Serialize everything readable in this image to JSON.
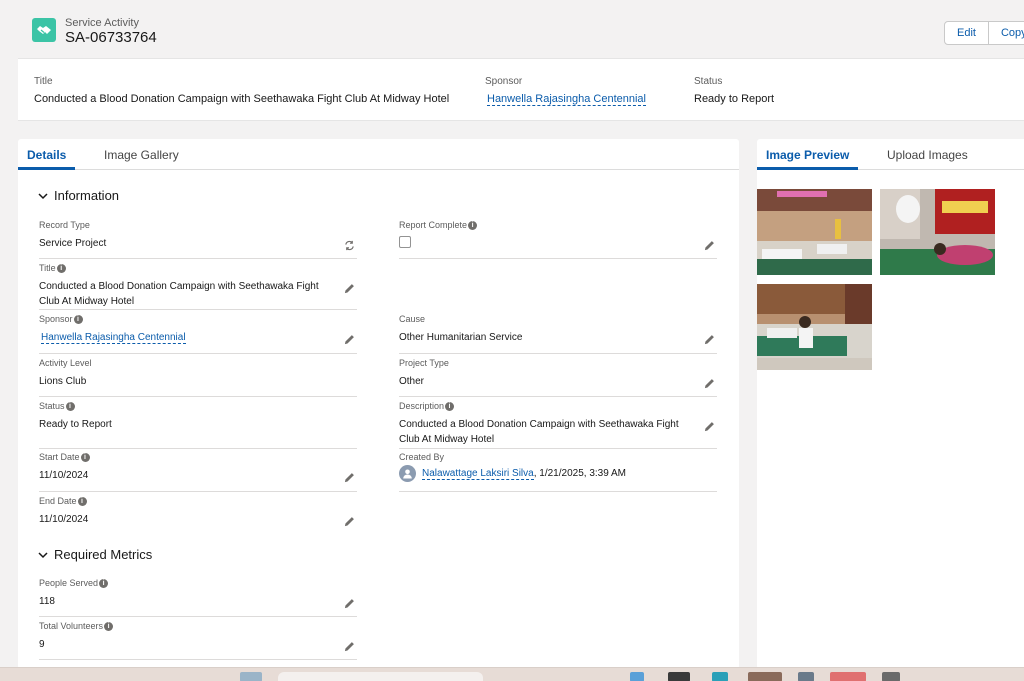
{
  "header": {
    "object_type": "Service Activity",
    "record_name": "SA-06733764",
    "buttons": {
      "edit": "Edit",
      "copy": "Copy"
    }
  },
  "highlights": {
    "title_label": "Title",
    "title_value": "Conducted a Blood Donation Campaign with Seethawaka Fight Club At Midway Hotel",
    "sponsor_label": "Sponsor",
    "sponsor_value": "Hanwella Rajasingha Centennial",
    "status_label": "Status",
    "status_value": "Ready to Report"
  },
  "main_tabs": {
    "details": "Details",
    "gallery": "Image Gallery"
  },
  "sections": {
    "information": "Information",
    "metrics": "Required Metrics"
  },
  "fields": {
    "record_type_label": "Record Type",
    "record_type_value": "Service Project",
    "report_complete_label": "Report Complete",
    "title_label": "Title",
    "title_value": "Conducted a Blood Donation Campaign with Seethawaka Fight Club At Midway Hotel",
    "sponsor_label": "Sponsor",
    "sponsor_value": "Hanwella Rajasingha Centennial",
    "cause_label": "Cause",
    "cause_value": "Other Humanitarian Service",
    "activity_level_label": "Activity Level",
    "activity_level_value": "Lions Club",
    "project_type_label": "Project Type",
    "project_type_value": "Other",
    "status_label": "Status",
    "status_value": "Ready to Report",
    "description_label": "Description",
    "description_value": "Conducted a Blood Donation Campaign with Seethawaka Fight Club At Midway Hotel",
    "start_date_label": "Start Date",
    "start_date_value": "11/10/2024",
    "created_by_label": "Created By",
    "created_by_user": "Nalawattage Laksiri Silva",
    "created_by_date": ", 1/21/2025, 3:39 AM",
    "end_date_label": "End Date",
    "end_date_value": "11/10/2024",
    "people_served_label": "People Served",
    "people_served_value": "118",
    "total_volunteers_label": "Total Volunteers",
    "total_volunteers_value": "9"
  },
  "side_tabs": {
    "preview": "Image Preview",
    "upload": "Upload Images"
  },
  "icons": {
    "object": "handshake-icon",
    "info": "info-icon",
    "edit": "pencil-icon",
    "change_record_type": "swap-icon",
    "chevron": "chevron-down-icon",
    "user": "user-avatar-icon"
  },
  "colors": {
    "brand": "#0b5cab",
    "object_icon": "#3bc4a6",
    "background": "#f3f2f2"
  }
}
